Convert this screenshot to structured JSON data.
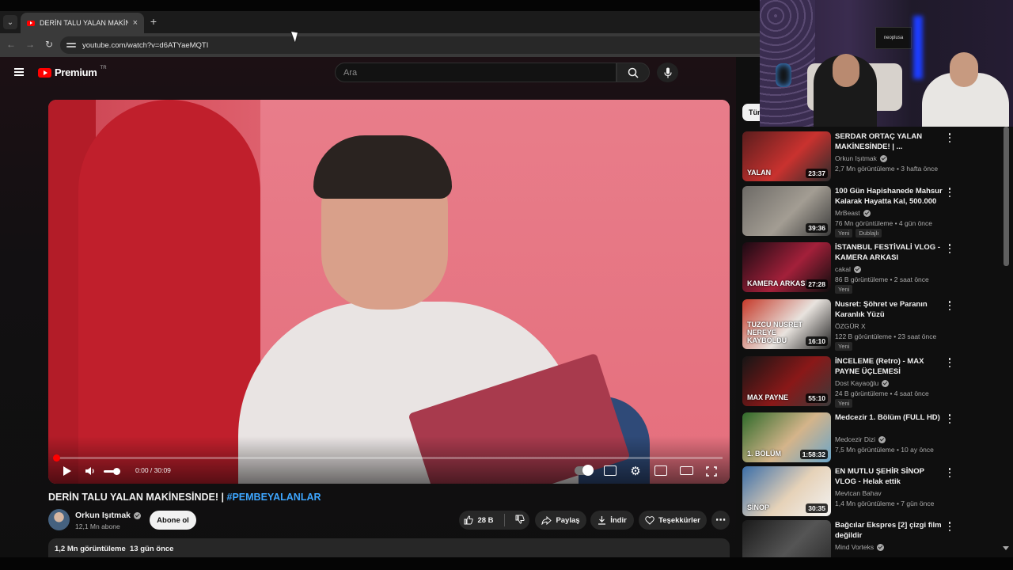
{
  "browser": {
    "tab_title": "DERİN TALU YALAN MAKİNESİNDE! | #PEMBEYALANLAR",
    "new_tab_label": "+",
    "close_tab_label": "×",
    "url": "youtube.com/watch?v=d6ATYaeMQTI"
  },
  "header": {
    "logo_text": "Premium",
    "logo_region": "TR",
    "search_placeholder": "Ara"
  },
  "player": {
    "time": "0:00 / 30:09",
    "progress": 0.0
  },
  "video": {
    "title": "DERİN TALU YALAN MAKİNESİNDE! | ",
    "hashtag": "#PEMBEYALANLAR",
    "channel": "Orkun Işıtmak",
    "subscribers": "12,1 Mn abone",
    "subscribe_label": "Abone ol",
    "likes": "28 B",
    "share_label": "Paylaş",
    "download_label": "İndir",
    "thanks_label": "Teşekkürler",
    "views": "1,2 Mn görüntüleme",
    "age": "13 gün önce"
  },
  "sidebar": {
    "chip": "Tümü",
    "items": [
      {
        "title": "SERDAR ORTAÇ YALAN MAKİNESİNDE! | ...",
        "channel": "Orkun Işıtmak",
        "verified": true,
        "meta": "2,7 Mn görüntüleme • 3 hafta önce",
        "duration": "23:37",
        "badges": [],
        "thumb_text": "YALAN",
        "thumb_colors": [
          "#5a1d1d",
          "#c9322f",
          "#2b2b2b"
        ]
      },
      {
        "title": "100 Gün Hapishanede Mahsur Kalarak Hayatta Kal, 500.000 ...",
        "channel": "MrBeast",
        "verified": true,
        "meta": "76 Mn görüntüleme • 4 gün önce",
        "duration": "39:36",
        "badges": [
          "Yeni",
          "Dublajlı"
        ],
        "thumb_text": "",
        "thumb_colors": [
          "#6d6a66",
          "#a39d93",
          "#3a3a3a"
        ]
      },
      {
        "title": "İSTANBUL FESTİVALİ VLOG - KAMERA ARKASI",
        "channel": "cakal",
        "verified": true,
        "meta": "86 B görüntüleme • 2 saat önce",
        "duration": "27:28",
        "badges": [
          "Yeni"
        ],
        "thumb_text": "KAMERA ARKASI",
        "thumb_colors": [
          "#1a0a12",
          "#a3203a",
          "#0d0d0d"
        ]
      },
      {
        "title": "Nusret: Şöhret ve Paranın Karanlık Yüzü",
        "channel": "ÖZGÜR X",
        "verified": false,
        "meta": "122 B görüntüleme • 23 saat önce",
        "duration": "16:10",
        "badges": [
          "Yeni"
        ],
        "thumb_text": "TUZCU NUSRET NEREYE KAYBOLDU",
        "thumb_colors": [
          "#c63a2a",
          "#e8e3de",
          "#202020"
        ]
      },
      {
        "title": "İNCELEME (Retro) - MAX PAYNE ÜÇLEMESİ",
        "channel": "Dost Kayaoğlu",
        "verified": true,
        "meta": "24 B görüntüleme • 4 saat önce",
        "duration": "55:10",
        "badges": [
          "Yeni"
        ],
        "thumb_text": "MAX PAYNE",
        "thumb_colors": [
          "#151515",
          "#8a1818",
          "#3a3a3a"
        ]
      },
      {
        "title": "Medcezir 1. Bölüm (FULL HD)",
        "channel": "Medcezir Dizi",
        "verified": true,
        "meta": "7,5 Mn görüntüleme • 10 ay önce",
        "duration": "1:58:32",
        "badges": [],
        "thumb_text": "1. BÖLÜM",
        "thumb_colors": [
          "#2f6a2a",
          "#d4b48a",
          "#6aa5c8"
        ]
      },
      {
        "title": "EN MUTLU ŞEHİR SİNOP VLOG - Helak ettik",
        "channel": "Mevtcan Bahav",
        "verified": false,
        "meta": "1,4 Mn görüntüleme • 7 gün önce",
        "duration": "30:35",
        "badges": [],
        "thumb_text": "SİNOP",
        "thumb_colors": [
          "#3b6ea8",
          "#e6d2b8",
          "#f2f2f2"
        ]
      },
      {
        "title": "Bağcılar Ekspres [2] çizgi film değildir",
        "channel": "Mind Vorteks",
        "verified": true,
        "meta": "",
        "duration": "",
        "badges": [],
        "thumb_text": "",
        "thumb_colors": [
          "#1a1a1a",
          "#555555",
          "#2a2a2a"
        ]
      }
    ]
  },
  "webcam": {
    "screen_text": "neoplusa"
  }
}
